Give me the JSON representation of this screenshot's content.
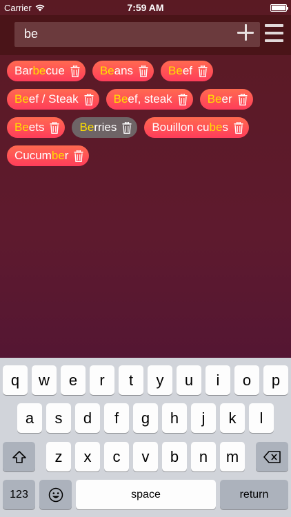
{
  "status": {
    "carrier": "Carrier",
    "time": "7:59 AM"
  },
  "search": {
    "value": "be"
  },
  "tags": [
    [
      {
        "pre": "Bar",
        "hl": "be",
        "post": "cue"
      },
      {
        "pre": "",
        "hl": "Be",
        "post": "ans"
      },
      {
        "pre": "",
        "hl": "Be",
        "post": "ef"
      }
    ],
    [
      {
        "pre": "",
        "hl": "Be",
        "post": "ef / Steak"
      },
      {
        "pre": "",
        "hl": "Be",
        "post": "ef, steak"
      },
      {
        "pre": "",
        "hl": "Be",
        "post": "er"
      }
    ],
    [
      {
        "pre": "",
        "hl": "Be",
        "post": "ets"
      },
      {
        "pre": "",
        "hl": "Be",
        "post": "rries",
        "muted": true
      },
      {
        "pre": "Bouillon cu",
        "hl": "be",
        "post": "s"
      }
    ],
    [
      {
        "pre": "Cucum",
        "hl": "be",
        "post": "r"
      }
    ]
  ],
  "keyboard": {
    "row1": [
      "q",
      "w",
      "e",
      "r",
      "t",
      "y",
      "u",
      "i",
      "o",
      "p"
    ],
    "row2": [
      "a",
      "s",
      "d",
      "f",
      "g",
      "h",
      "j",
      "k",
      "l"
    ],
    "row3": [
      "z",
      "x",
      "c",
      "v",
      "b",
      "n",
      "m"
    ],
    "numbers_label": "123",
    "space_label": "space",
    "return_label": "return"
  }
}
